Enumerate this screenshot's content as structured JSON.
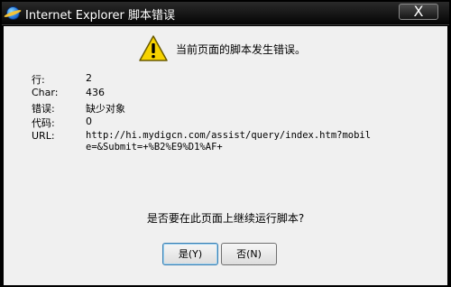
{
  "window": {
    "title": "Internet Explorer 脚本错误",
    "close_label": "X"
  },
  "dialog": {
    "message": "当前页面的脚本发生错误。",
    "details": [
      {
        "label": "行:",
        "value": "2"
      },
      {
        "label": "Char:",
        "value": "436"
      },
      {
        "label": "错误:",
        "value": "缺少对象"
      },
      {
        "label": "代码:",
        "value": "0"
      }
    ],
    "url_label": "URL:",
    "url_value": "http://hi.mydigcn.com/assist/query/index.htm?mobile=&Submit=+%B2%E9%D1%AF+",
    "question": "是否要在此页面上继续运行脚本?",
    "yes_label": "是(Y)",
    "no_label": "否(N)"
  },
  "icons": {
    "app": "internet-explorer-icon",
    "warning": "warning-icon",
    "warning_color": "#f7d300"
  }
}
